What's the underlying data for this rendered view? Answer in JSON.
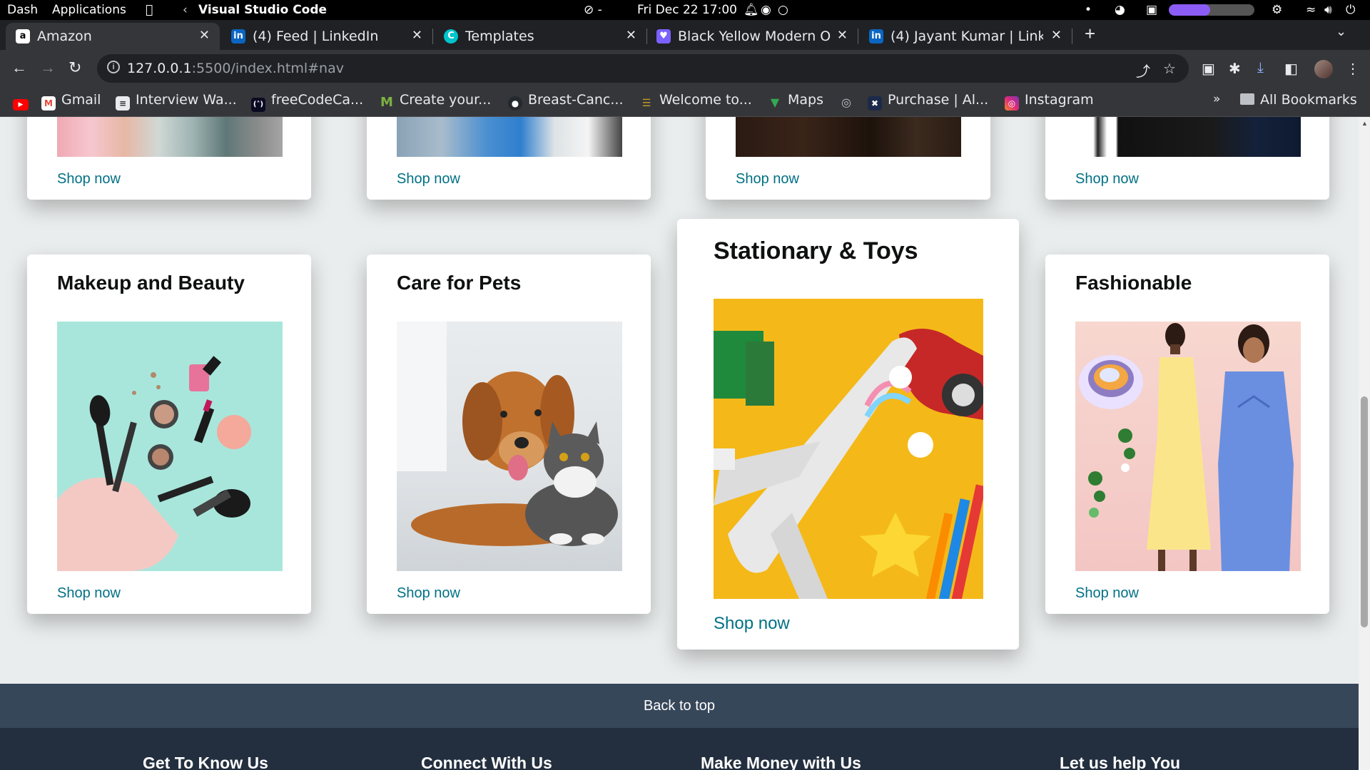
{
  "os": {
    "dash": "Dash",
    "applications": "Applications",
    "active_app": "Visual Studio Code",
    "status": "⊘ -",
    "datetime": "Fri Dec 22  17:00",
    "battery_fraction": 0.48
  },
  "tabs": [
    {
      "title": "Amazon",
      "favicon": "amazon-icon",
      "active": true
    },
    {
      "title": "(4) Feed | LinkedIn",
      "favicon": "linkedin-icon",
      "active": false
    },
    {
      "title": "Templates",
      "favicon": "canva-icon",
      "active": false
    },
    {
      "title": "Black Yellow Modern O",
      "favicon": "heart-icon",
      "active": false
    },
    {
      "title": "(4) Jayant Kumar | Link",
      "favicon": "linkedin-icon",
      "active": false
    }
  ],
  "address": {
    "host": "127.0.0.1",
    "rest": ":5500/index.html#nav"
  },
  "bookmarks": [
    {
      "label": "",
      "icon": "youtube-icon"
    },
    {
      "label": "Gmail",
      "icon": "gmail-icon"
    },
    {
      "label": "Interview Wa...",
      "icon": "page-icon"
    },
    {
      "label": "freeCodeCa...",
      "icon": "freecodecamp-icon"
    },
    {
      "label": "Create your...",
      "icon": "m-icon"
    },
    {
      "label": "Breast-Canc...",
      "icon": "github-icon"
    },
    {
      "label": "Welcome to...",
      "icon": "bookmark-icon"
    },
    {
      "label": "Maps",
      "icon": "maps-icon"
    },
    {
      "label": "",
      "icon": "globe-icon"
    },
    {
      "label": "Purchase | Al...",
      "icon": "x-icon"
    },
    {
      "label": "Instagram",
      "icon": "instagram-icon"
    }
  ],
  "bookmarks_overflow": "»",
  "all_bookmarks": "All Bookmarks",
  "top_row_cards": [
    {
      "shop": "Shop now"
    },
    {
      "shop": "Shop now"
    },
    {
      "shop": "Shop now"
    },
    {
      "shop": "Shop now"
    }
  ],
  "cards": [
    {
      "title": "Makeup and Beauty",
      "shop": "Shop now"
    },
    {
      "title": "Care for Pets",
      "shop": "Shop now"
    },
    {
      "title": "Stationary & Toys",
      "shop": "Shop now"
    },
    {
      "title": "Fashionable",
      "shop": "Shop now"
    }
  ],
  "back_to_top": "Back to top",
  "footer_headings": [
    "Get To Know Us",
    "Connect With Us",
    "Make Money with Us",
    "Let us help You"
  ],
  "colors": {
    "link": "#007185",
    "footer_top": "#37475a",
    "footer": "#232f3e",
    "page_bg": "#eaeded"
  }
}
